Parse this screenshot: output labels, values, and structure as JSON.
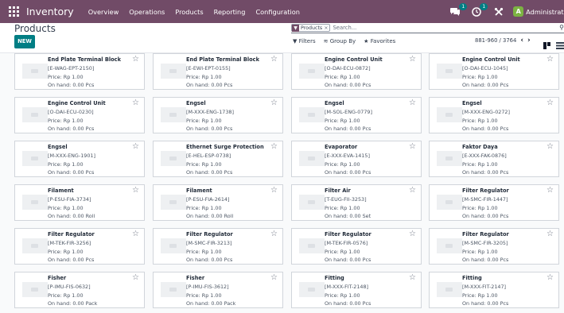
{
  "navbar": {
    "brand": "Inventory",
    "menu": [
      "Overview",
      "Operations",
      "Products",
      "Reporting",
      "Configuration"
    ],
    "chat_badge": "1",
    "activity_badge": "1",
    "avatar_letter": "A",
    "username": "Administrator"
  },
  "control_panel": {
    "breadcrumb": "Products",
    "new_label": "NEW",
    "facet_label": "Products",
    "facet_remove": "×",
    "search_placeholder": "Search...",
    "filters_label": "Filters",
    "groupby_label": "Group By",
    "favorites_label": "Favorites",
    "pager_value": "881-960 / 3764"
  },
  "colors": {
    "brand": "#714b67",
    "accent": "#017e84"
  },
  "products": [
    {
      "name": "End Plate Terminal Block",
      "code": "[E-WAG-EPT-2150]",
      "price": "Price: Rp 1.00",
      "onhand": "On hand: 0.00 Pcs"
    },
    {
      "name": "End Plate Terminal Block",
      "code": "[E-EWI-EPT-0155]",
      "price": "Price: Rp 1.00",
      "onhand": "On hand: 0.00 Pcs"
    },
    {
      "name": "Engine Control Unit",
      "code": "[O-DAI-ECU-0872]",
      "price": "Price: Rp 1.00",
      "onhand": "On hand: 0.00 Pcs"
    },
    {
      "name": "Engine Control Unit",
      "code": "[O-DAI-ECU-1045]",
      "price": "Price: Rp 1.00",
      "onhand": "On hand: 0.00 Pcs"
    },
    {
      "name": "Engine Control Unit",
      "code": "[O-DAI-ECU-0230]",
      "price": "Price: Rp 1.00",
      "onhand": "On hand: 0.00 Pcs"
    },
    {
      "name": "Engsel",
      "code": "[M-XXX-ENG-1738]",
      "price": "Price: Rp 1.00",
      "onhand": "On hand: 0.00 Pcs"
    },
    {
      "name": "Engsel",
      "code": "[M-SOL-ENG-0779]",
      "price": "Price: Rp 1.00",
      "onhand": "On hand: 0.00 Pcs"
    },
    {
      "name": "Engsel",
      "code": "[M-XXX-ENG-0272]",
      "price": "Price: Rp 1.00",
      "onhand": "On hand: 0.00 Pcs"
    },
    {
      "name": "Engsel",
      "code": "[M-XXX-ENG-1901]",
      "price": "Price: Rp 1.00",
      "onhand": "On hand: 0.00 Pcs"
    },
    {
      "name": "Ethernet Surge Protection",
      "code": "[E-HEL-ESP-0738]",
      "price": "Price: Rp 1.00",
      "onhand": "On hand: 0.00 Pcs"
    },
    {
      "name": "Evaporator",
      "code": "[E-XXX-EVA-1415]",
      "price": "Price: Rp 1.00",
      "onhand": "On hand: 0.00 Pcs"
    },
    {
      "name": "Faktor Daya",
      "code": "[E-XXX-FAK-0876]",
      "price": "Price: Rp 1.00",
      "onhand": "On hand: 0.00 Pcs"
    },
    {
      "name": "Filament",
      "code": "[P-ESU-FIA-3734]",
      "price": "Price: Rp 1.00",
      "onhand": "On hand: 0.00 Roll"
    },
    {
      "name": "Filament",
      "code": "[P-ESU-FIA-2614]",
      "price": "Price: Rp 1.00",
      "onhand": "On hand: 0.00 Roll"
    },
    {
      "name": "Filter Air",
      "code": "[T-EUG-FII-3253]",
      "price": "Price: Rp 1.00",
      "onhand": "On hand: 0.00 Set"
    },
    {
      "name": "Filter Regulator",
      "code": "[M-SMC-FIR-1447]",
      "price": "Price: Rp 1.00",
      "onhand": "On hand: 0.00 Pcs"
    },
    {
      "name": "Filter Regulator",
      "code": "[M-TEK-FIR-3256]",
      "price": "Price: Rp 1.00",
      "onhand": "On hand: 0.00 Pcs"
    },
    {
      "name": "Filter Regulator",
      "code": "[M-SMC-FIR-3213]",
      "price": "Price: Rp 1.00",
      "onhand": "On hand: 0.00 Pcs"
    },
    {
      "name": "Filter Regulator",
      "code": "[M-TEK-FIR-0576]",
      "price": "Price: Rp 1.00",
      "onhand": "On hand: 0.00 Pcs"
    },
    {
      "name": "Filter Regulator",
      "code": "[M-SMC-FIR-3205]",
      "price": "Price: Rp 1.00",
      "onhand": "On hand: 0.00 Pcs"
    },
    {
      "name": "Fisher",
      "code": "[P-IMU-FIS-0632]",
      "price": "Price: Rp 1.00",
      "onhand": "On hand: 0.00 Pack"
    },
    {
      "name": "Fisher",
      "code": "[P-IMU-FIS-3612]",
      "price": "Price: Rp 1.00",
      "onhand": "On hand: 0.00 Pack"
    },
    {
      "name": "Fitting",
      "code": "[M-XXX-FIT-2148]",
      "price": "Price: Rp 1.00",
      "onhand": "On hand: 0.00 Pcs"
    },
    {
      "name": "Fitting",
      "code": "[M-XXX-FIT-2147]",
      "price": "Price: Rp 1.00",
      "onhand": "On hand: 0.00 Pcs"
    }
  ]
}
